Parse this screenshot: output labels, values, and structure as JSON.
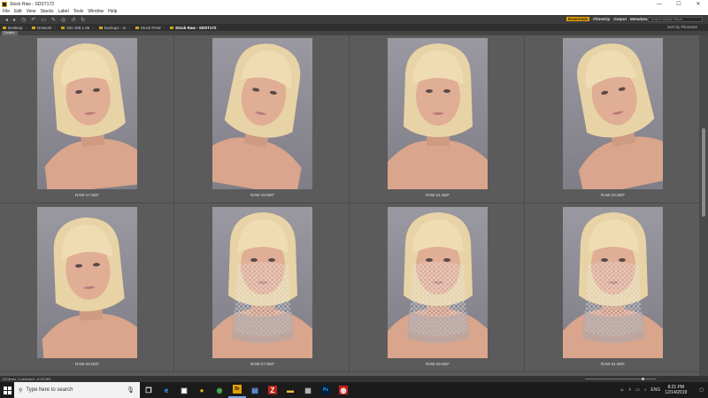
{
  "window": {
    "title": "Stock Raw - SDST172"
  },
  "menu": [
    "File",
    "Edit",
    "View",
    "Stacks",
    "Label",
    "Tools",
    "Window",
    "Help"
  ],
  "workspaces": [
    {
      "label": "Essentials",
      "active": true
    },
    {
      "label": "Filmstrip",
      "active": false
    },
    {
      "label": "Output",
      "active": false
    },
    {
      "label": "Metadata",
      "active": false
    }
  ],
  "search": {
    "placeholder": "Search Adobe Stock"
  },
  "breadcrumb": [
    "Desktop",
    "Network",
    "192.168.1.86",
    "backups - m",
    "Stock RAW",
    "Stock Raw - SDST172"
  ],
  "sort": {
    "label": "Sort by Filename"
  },
  "content_tab": {
    "label": "Content"
  },
  "thumbnails": [
    {
      "caption": "RAW-17.NEF",
      "veil": false,
      "pose": "tilt"
    },
    {
      "caption": "RAW-19.NEF",
      "veil": false,
      "pose": "tilt-right"
    },
    {
      "caption": "RAW-21.NEF",
      "veil": false,
      "pose": "straight"
    },
    {
      "caption": "RAW-23.NEF",
      "veil": false,
      "pose": "tilt-left"
    },
    {
      "caption": "RAW-25.NEF",
      "veil": false,
      "pose": "low"
    },
    {
      "caption": "RAW-27.NEF",
      "veil": true,
      "pose": "straight"
    },
    {
      "caption": "RAW-29.NEF",
      "veil": true,
      "pose": "straight"
    },
    {
      "caption": "RAW-31.NEF",
      "veil": true,
      "pose": "straight"
    }
  ],
  "status": {
    "text": "26 items, 1 selected - 8.00 MB"
  },
  "taskbar": {
    "search_placeholder": "Type here to search",
    "apps": [
      {
        "name": "task-view-icon",
        "glyph": "❐",
        "color": "#ffffff",
        "bg": "transparent"
      },
      {
        "name": "edge-icon",
        "glyph": "e",
        "color": "#3aa0ff",
        "bg": "transparent"
      },
      {
        "name": "store-icon",
        "glyph": "▣",
        "color": "#ffffff",
        "bg": "transparent"
      },
      {
        "name": "chrome-icon",
        "glyph": "●",
        "color": "#e8b400",
        "bg": "transparent"
      },
      {
        "name": "browser-icon",
        "glyph": "◉",
        "color": "#4caf50",
        "bg": "transparent"
      },
      {
        "name": "bridge-icon",
        "glyph": "Br",
        "color": "#1c1c1c",
        "bg": "#e5a000"
      },
      {
        "name": "explorer-icon",
        "glyph": "▤",
        "color": "#6ea8ff",
        "bg": "transparent"
      },
      {
        "name": "filezilla-icon",
        "glyph": "Z",
        "color": "#ffffff",
        "bg": "#b8241c"
      },
      {
        "name": "folder-icon",
        "glyph": "▬",
        "color": "#f0c040",
        "bg": "transparent"
      },
      {
        "name": "calculator-icon",
        "glyph": "▦",
        "color": "#bbbbbb",
        "bg": "transparent"
      },
      {
        "name": "photoshop-icon",
        "glyph": "Ps",
        "color": "#31a8ff",
        "bg": "#001e36"
      },
      {
        "name": "app-red-icon",
        "glyph": "◍",
        "color": "#ffffff",
        "bg": "#c8201a"
      }
    ],
    "tray_lang": "ENG",
    "time": "8:21 PM",
    "date": "12/14/2019"
  }
}
